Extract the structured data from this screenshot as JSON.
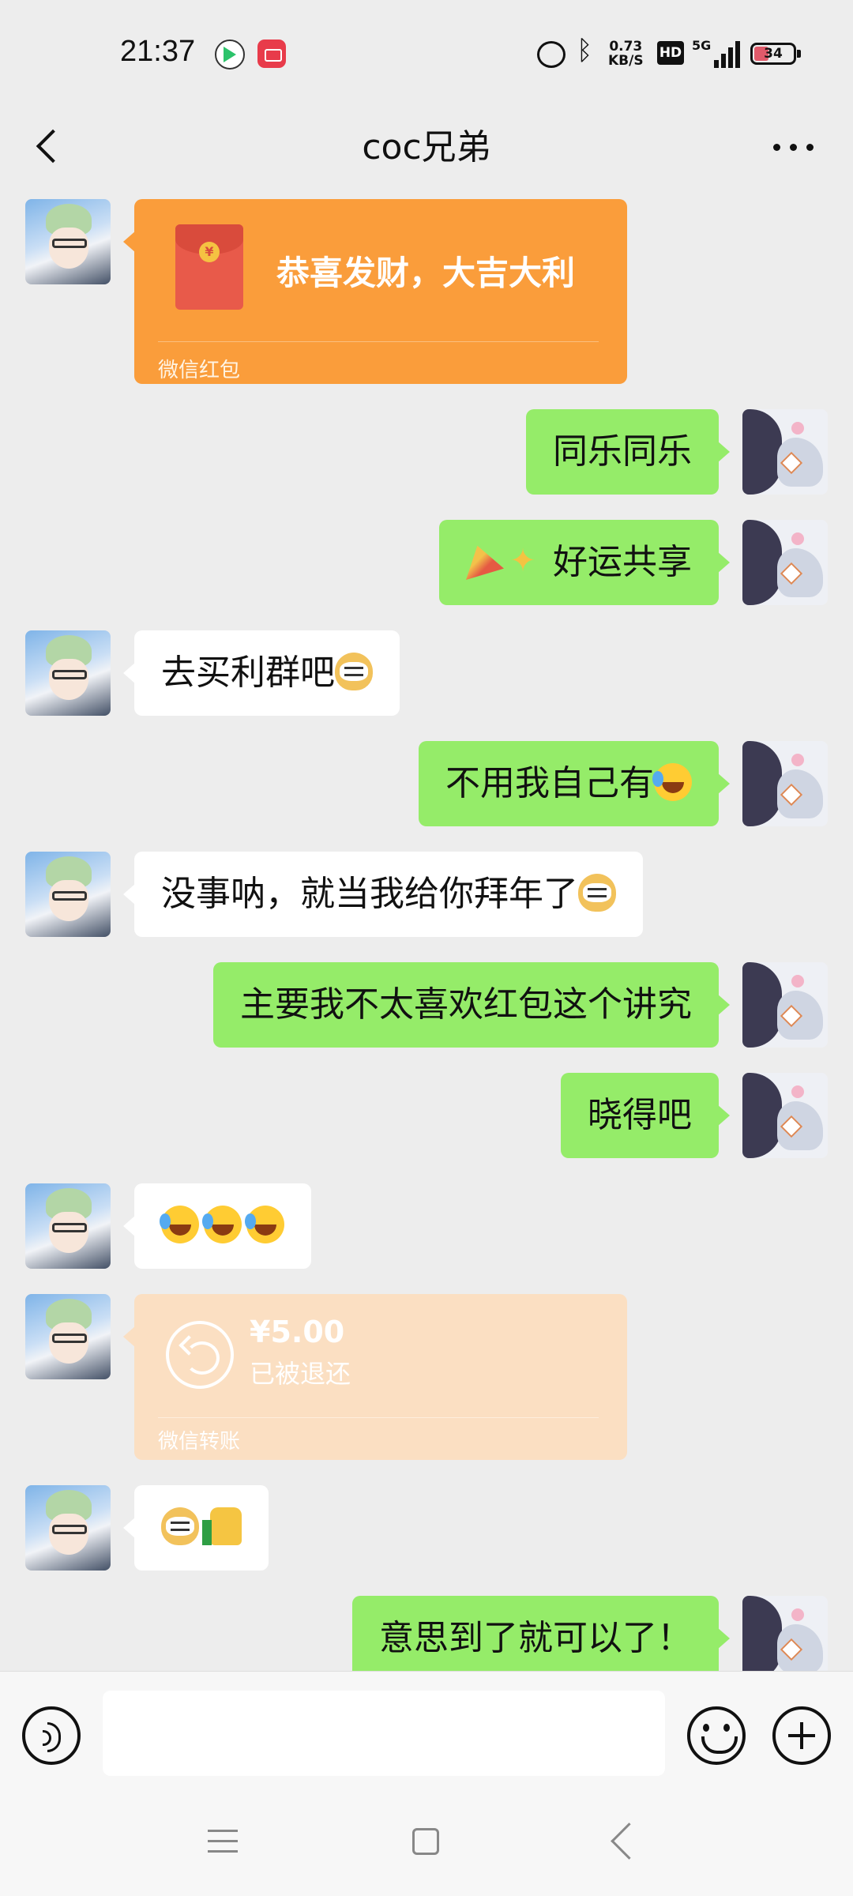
{
  "status_bar": {
    "time": "21:37",
    "net_speed_value": "0.73",
    "net_speed_unit": "KB/S",
    "hd_label": "HD",
    "network_label": "5G",
    "battery": "34",
    "icons": [
      "video-app-icon",
      "screen-record-icon",
      "alarm-icon",
      "bluetooth-icon",
      "signal-icon",
      "battery-icon"
    ]
  },
  "header": {
    "title": "coc兄弟",
    "icons": [
      "back-icon",
      "more-icon"
    ]
  },
  "chat": {
    "red_packet": {
      "greeting": "恭喜发财，大吉大利",
      "label": "微信红包"
    },
    "messages": [
      {
        "side": "right",
        "text": "同乐同乐"
      },
      {
        "side": "right",
        "text": "好运共享",
        "emoji_prefix": [
          "party-popper",
          "sparkles"
        ]
      },
      {
        "side": "left",
        "text": "去买利群吧",
        "emoji_suffix": [
          "doge"
        ]
      },
      {
        "side": "right",
        "text": "不用我自己有",
        "emoji_suffix": [
          "laugh-cry"
        ]
      },
      {
        "side": "left",
        "text": "没事呐，就当我给你拜年了",
        "emoji_suffix": [
          "doge"
        ]
      },
      {
        "side": "right",
        "text": "主要我不太喜欢红包这个讲究"
      },
      {
        "side": "right",
        "text": "晓得吧"
      },
      {
        "side": "left",
        "text": "",
        "emoji_only": [
          "laugh-cry",
          "laugh-cry",
          "laugh-cry"
        ]
      },
      {
        "side": "left",
        "text": "",
        "emoji_only": [
          "doge",
          "thumbs-up"
        ]
      },
      {
        "side": "right",
        "text": "意思到了就可以了！"
      }
    ],
    "transfer": {
      "amount": "¥5.00",
      "status": "已被退还",
      "label": "微信转账"
    }
  },
  "input_bar": {
    "value": "",
    "icons": [
      "voice-icon",
      "emoji-icon",
      "plus-icon"
    ]
  },
  "colors": {
    "background": "#ededed",
    "bubble_self": "#95ec69",
    "bubble_other": "#ffffff",
    "red_packet": "#fa9d3b",
    "transfer_returned": "#fbdfc2"
  }
}
